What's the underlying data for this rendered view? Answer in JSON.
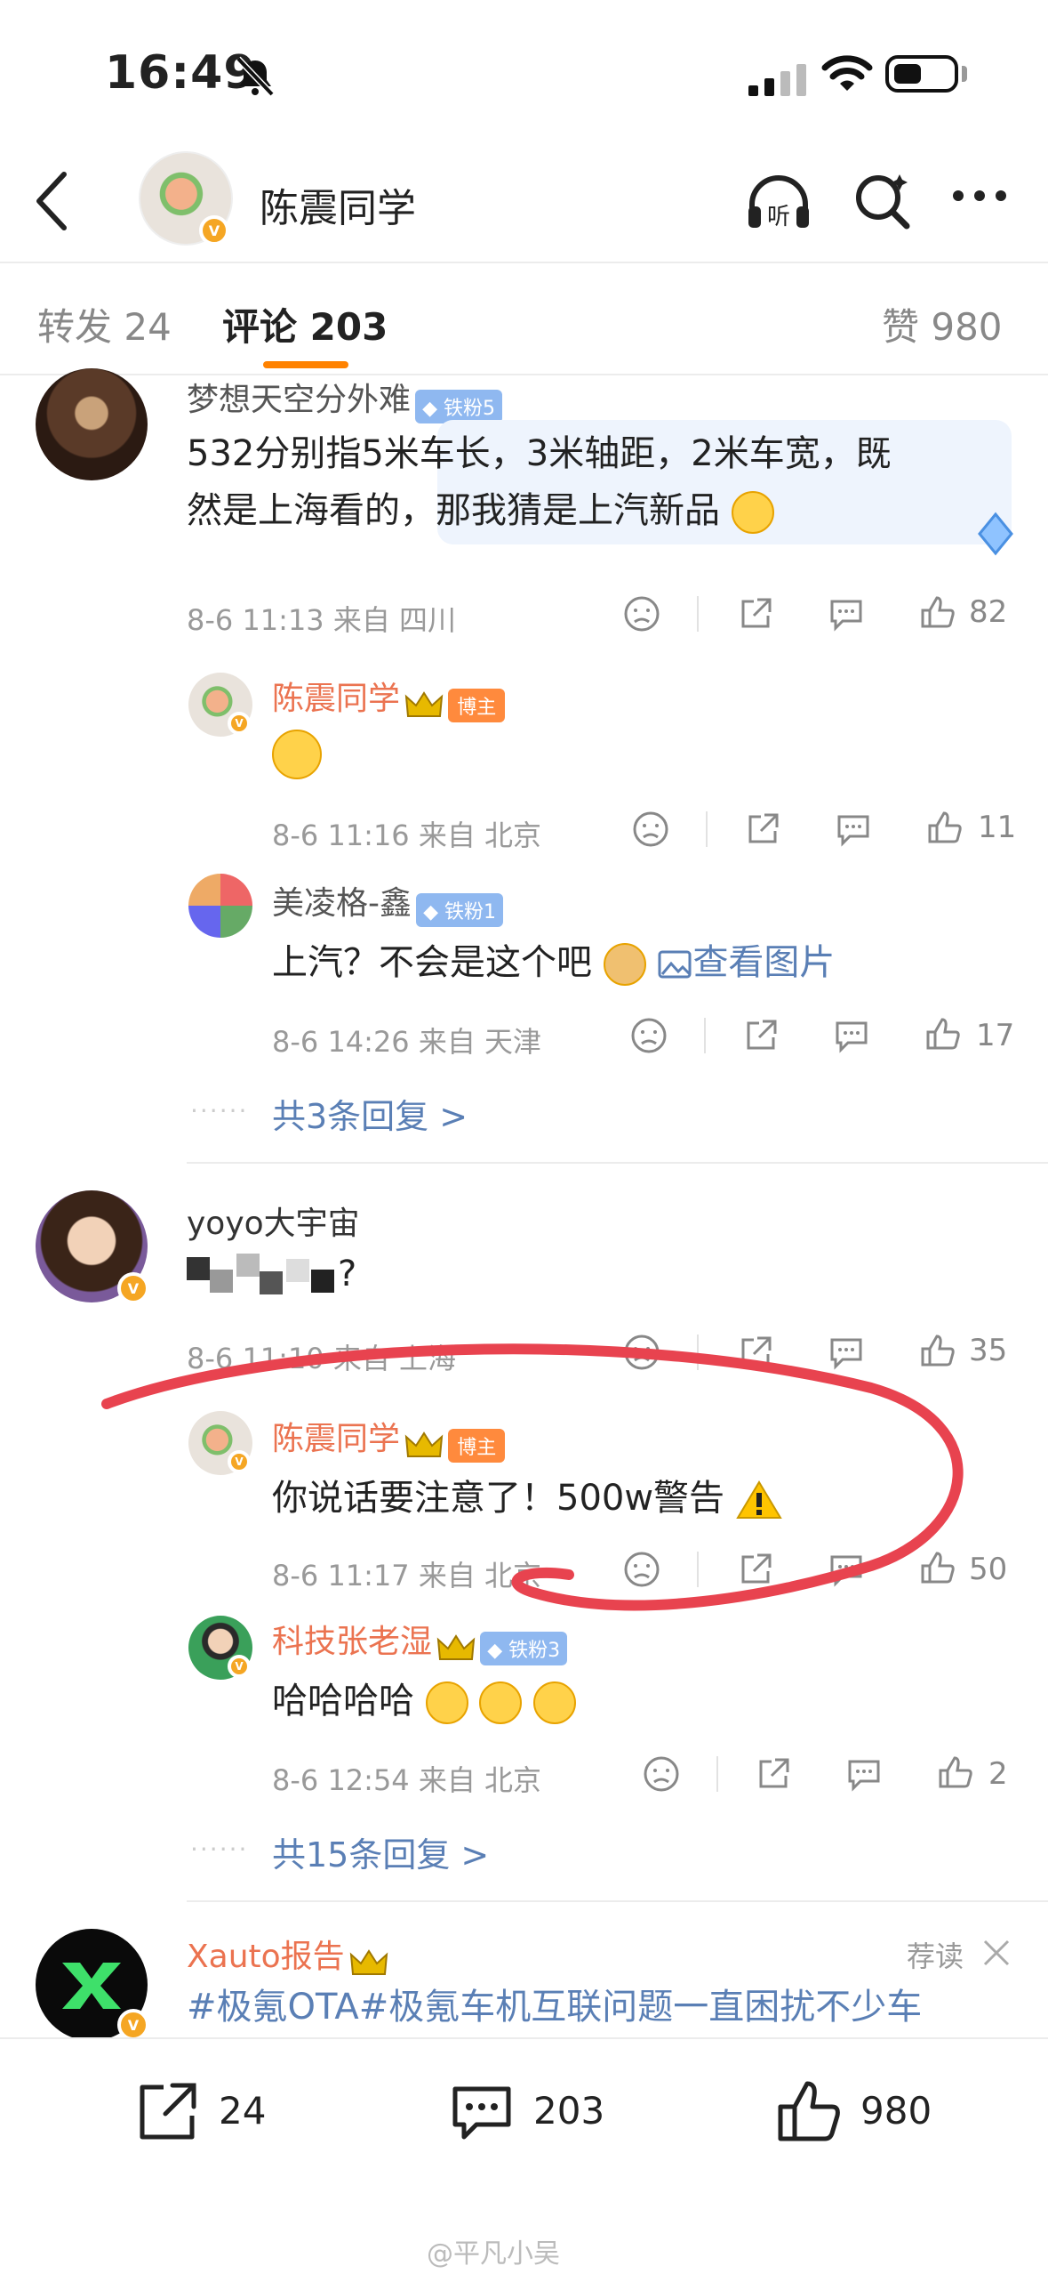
{
  "status_bar": {
    "time": "16:49"
  },
  "header": {
    "title": "陈震同学"
  },
  "tabs": {
    "repost": "转发 24",
    "comment": "评论 203",
    "like": "赞 980"
  },
  "comments": [
    {
      "user": "梦想天空分外难",
      "badge": "铁粉5",
      "text_line1": "532分别指5米车长，3米轴距，2米车宽，既",
      "text_line2": "然是上海看的，那我猜是上汽新品",
      "meta": "8-6 11:13 来自 四川",
      "likes": "82",
      "replies": [
        {
          "user": "陈震同学",
          "badge": "博主",
          "text": "",
          "meta": "8-6 11:16 来自 北京",
          "likes": "11"
        },
        {
          "user": "美凌格-鑫",
          "badge": "铁粉1",
          "text": "上汽？不会是这个吧",
          "link": "查看图片",
          "meta": "8-6 14:26 来自 天津",
          "likes": "17"
        }
      ],
      "more_replies": "共3条回复 >"
    },
    {
      "user": "yoyo大宇宙",
      "text": "?",
      "meta": "8-6 11:10 来自 上海",
      "likes": "35",
      "replies": [
        {
          "user": "陈震同学",
          "badge": "博主",
          "text": "你说话要注意了！500w警告",
          "meta": "8-6 11:17 来自 北京",
          "likes": "50"
        },
        {
          "user": "科技张老湿",
          "badge": "铁粉3",
          "text": "哈哈哈哈",
          "meta": "8-6 12:54 来自 北京",
          "likes": "2"
        }
      ],
      "more_replies": "共15条回复 >"
    },
    {
      "user": "Xauto报告",
      "recommend": "荐读",
      "text": "#极氪OTA#极氪车机互联问题一直困扰不少车"
    }
  ],
  "bottom_bar": {
    "reposts": "24",
    "comments": "203",
    "likes": "980"
  },
  "watermark": "@平凡小吴",
  "colors": {
    "accent": "#ff8200",
    "link": "#5a7fb5",
    "username_orange": "#eb7350",
    "annotation_red": "#e8434f"
  }
}
